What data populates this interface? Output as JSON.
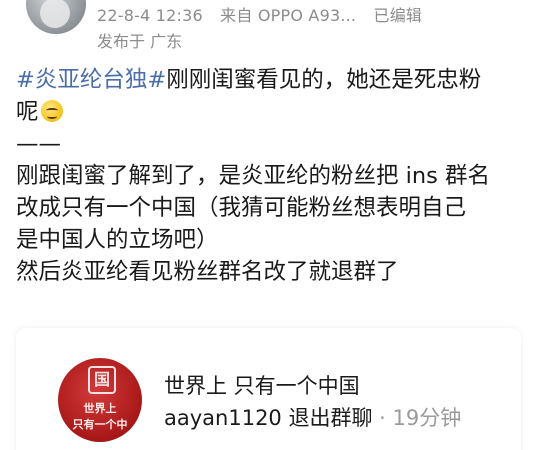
{
  "header": {
    "date": "22-8-4 12:36",
    "source": "来自 OPPO A93...",
    "edited": "已编辑",
    "location": "发布于 广东"
  },
  "post": {
    "hashtag": "#炎亚纶台独#",
    "line1_rest": "刚刚闺蜜看见的，她还是死忠粉",
    "line2": "呢",
    "emoji": "grinning-sweat-emoji",
    "separator": "——",
    "line3": "刚跟闺蜜了解到了，是炎亚纶的粉丝把 ins 群名",
    "line4": "改成只有一个中国（我猜可能粉丝想表明自己",
    "line5": "是中国人的立场吧）",
    "line6": "然后炎亚纶看见粉丝群名改了就退群了"
  },
  "group_card": {
    "avatar_seal": "国",
    "avatar_line1": "世界上",
    "avatar_line2": "只有一个中",
    "name": "世界上 只有一个中国",
    "event": "aayan1120 退出群聊",
    "time": "· 19分钟"
  },
  "colors": {
    "hashtag": "#4a6ea9",
    "meta": "#8c8c8c",
    "group_avatar": "#b02020"
  }
}
